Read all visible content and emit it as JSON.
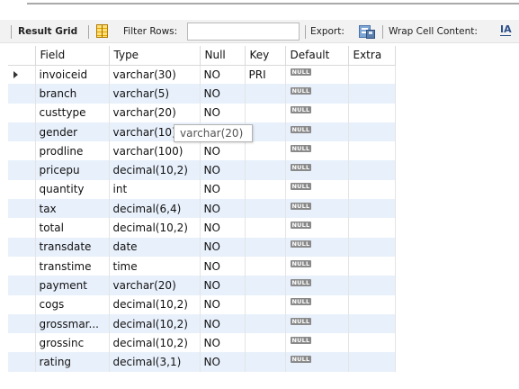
{
  "toolbar": {
    "result_grid_label": "Result Grid",
    "filter_rows_label": "Filter Rows:",
    "filter_rows_value": "",
    "export_label": "Export:",
    "wrap_cell_label": "Wrap Cell Content:",
    "wrap_icon_glyph": "IA"
  },
  "grid": {
    "columns": [
      "Field",
      "Type",
      "Null",
      "Key",
      "Default",
      "Extra"
    ],
    "null_badge": "NULL",
    "rows": [
      {
        "field": "invoiceid",
        "type": "varchar(30)",
        "null": "NO",
        "key": "PRI",
        "default": "NULL",
        "extra": ""
      },
      {
        "field": "branch",
        "type": "varchar(5)",
        "null": "NO",
        "key": "",
        "default": "NULL",
        "extra": ""
      },
      {
        "field": "custtype",
        "type": "varchar(20)",
        "null": "NO",
        "key": "",
        "default": "NULL",
        "extra": ""
      },
      {
        "field": "gender",
        "type": "varchar(10)",
        "null": "NO",
        "key": "",
        "default": "NULL",
        "extra": ""
      },
      {
        "field": "prodline",
        "type": "varchar(100)",
        "null": "NO",
        "key": "",
        "default": "NULL",
        "extra": ""
      },
      {
        "field": "pricepu",
        "type": "decimal(10,2)",
        "null": "NO",
        "key": "",
        "default": "NULL",
        "extra": ""
      },
      {
        "field": "quantity",
        "type": "int",
        "null": "NO",
        "key": "",
        "default": "NULL",
        "extra": ""
      },
      {
        "field": "tax",
        "type": "decimal(6,4)",
        "null": "NO",
        "key": "",
        "default": "NULL",
        "extra": ""
      },
      {
        "field": "total",
        "type": "decimal(10,2)",
        "null": "NO",
        "key": "",
        "default": "NULL",
        "extra": ""
      },
      {
        "field": "transdate",
        "type": "date",
        "null": "NO",
        "key": "",
        "default": "NULL",
        "extra": ""
      },
      {
        "field": "transtime",
        "type": "time",
        "null": "NO",
        "key": "",
        "default": "NULL",
        "extra": ""
      },
      {
        "field": "payment",
        "type": "varchar(20)",
        "null": "NO",
        "key": "",
        "default": "NULL",
        "extra": ""
      },
      {
        "field": "cogs",
        "type": "decimal(10,2)",
        "null": "NO",
        "key": "",
        "default": "NULL",
        "extra": ""
      },
      {
        "field": "grossmar...",
        "type": "decimal(10,2)",
        "null": "NO",
        "key": "",
        "default": "NULL",
        "extra": ""
      },
      {
        "field": "grossinc",
        "type": "decimal(10,2)",
        "null": "NO",
        "key": "",
        "default": "NULL",
        "extra": ""
      },
      {
        "field": "rating",
        "type": "decimal(3,1)",
        "null": "NO",
        "key": "",
        "default": "NULL",
        "extra": ""
      }
    ]
  },
  "tooltip": {
    "text": "varchar(20)"
  },
  "colors": {
    "alt_row": "#e8f0fb",
    "toolbar_bg": "#f2f2f2",
    "null_badge_bg": "#8a8a8a"
  }
}
